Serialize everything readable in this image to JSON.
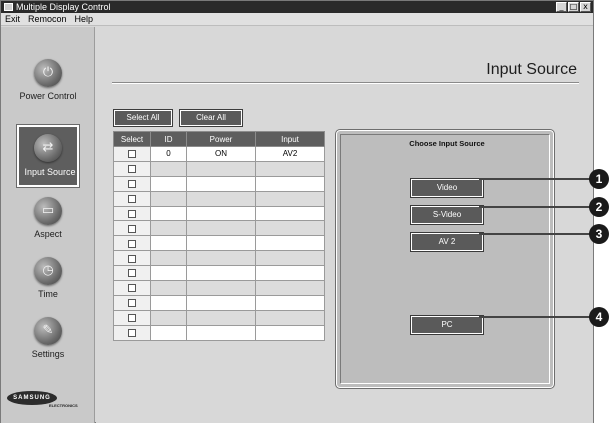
{
  "window": {
    "title": "Multiple Display Control",
    "min": "_",
    "max": "□",
    "close": "x"
  },
  "menu": [
    "Exit",
    "Remocon",
    "Help"
  ],
  "sidebar": {
    "items": [
      {
        "label": "Power Control",
        "icon": "power-icon",
        "glyph": "⏻"
      },
      {
        "label": "Input Source",
        "icon": "input-source-icon",
        "glyph": "⇄",
        "active": true
      },
      {
        "label": "Aspect",
        "icon": "aspect-icon",
        "glyph": "▭"
      },
      {
        "label": "Time",
        "icon": "time-icon",
        "glyph": "◷"
      },
      {
        "label": "Settings",
        "icon": "settings-icon",
        "glyph": "✎"
      }
    ],
    "logo": {
      "brand": "SAMSUNG",
      "sub": "ELECTRONICS"
    }
  },
  "main": {
    "title": "Input Source",
    "select_all": "Select All",
    "clear_all": "Clear All",
    "table": {
      "headers": [
        "Select",
        "ID",
        "Power",
        "Input"
      ],
      "rows": [
        {
          "id": "0",
          "power": "ON",
          "input": "AV2"
        },
        {
          "id": "",
          "power": "",
          "input": ""
        },
        {
          "id": "",
          "power": "",
          "input": ""
        },
        {
          "id": "",
          "power": "",
          "input": ""
        },
        {
          "id": "",
          "power": "",
          "input": ""
        },
        {
          "id": "",
          "power": "",
          "input": ""
        },
        {
          "id": "",
          "power": "",
          "input": ""
        },
        {
          "id": "",
          "power": "",
          "input": ""
        },
        {
          "id": "",
          "power": "",
          "input": ""
        },
        {
          "id": "",
          "power": "",
          "input": ""
        },
        {
          "id": "",
          "power": "",
          "input": ""
        },
        {
          "id": "",
          "power": "",
          "input": ""
        },
        {
          "id": "",
          "power": "",
          "input": ""
        }
      ]
    },
    "source_panel": {
      "title": "Choose Input Source",
      "buttons": [
        "Video",
        "S-Video",
        "AV 2",
        "PC"
      ]
    }
  },
  "callouts": [
    "1",
    "2",
    "3",
    "4"
  ],
  "colors": {
    "button": "#5a5a5a",
    "sidebar": "#c9c9c9",
    "panel": "#bdbdbd",
    "titlebar": "#2a2a2a"
  }
}
